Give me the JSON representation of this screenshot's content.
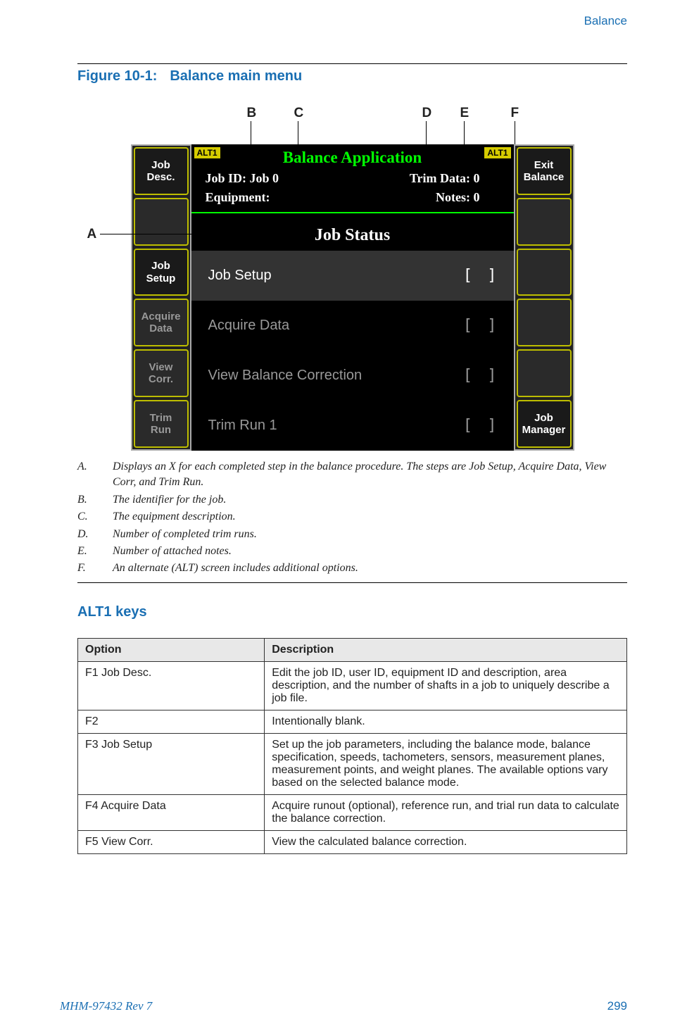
{
  "header": {
    "section_title": "Balance"
  },
  "figure": {
    "label": "Figure 10-1:",
    "title": "Balance main menu",
    "callouts": {
      "A": "A",
      "B": "B",
      "C": "C",
      "D": "D",
      "E": "E",
      "F": "F"
    }
  },
  "device": {
    "alt_chip": "ALT1",
    "app_title": "Balance Application",
    "info": {
      "job_id_label": "Job ID:",
      "job_id_value": "Job 0",
      "trim_label": "Trim Data:",
      "trim_value": "0",
      "equipment_label": "Equipment:",
      "equipment_value": "",
      "notes_label": "Notes:",
      "notes_value": "0"
    },
    "job_status_heading": "Job Status",
    "status_items": [
      {
        "label": "Job Setup",
        "mark": "[   ]"
      },
      {
        "label": "Acquire Data",
        "mark": "[   ]"
      },
      {
        "label": "View Balance Correction",
        "mark": "[   ]"
      },
      {
        "label": "Trim Run 1",
        "mark": "[   ]"
      }
    ],
    "left_buttons": {
      "b1": "Job\nDesc.",
      "b2": "",
      "b3": "Job\nSetup",
      "b4": "Acquire\nData",
      "b5": "View\nCorr.",
      "b6": "Trim\nRun"
    },
    "right_buttons": {
      "b1": "Exit\nBalance",
      "b2": "",
      "b3": "",
      "b4": "",
      "b5": "",
      "b6": "Job\nManager"
    }
  },
  "legend": {
    "A": "Displays an X for each completed step in the balance procedure. The steps are Job Setup, Acquire Data, View Corr, and Trim Run.",
    "B": "The identifier for the job.",
    "C": "The equipment description.",
    "D": "Number of completed trim runs.",
    "E": "Number of attached notes.",
    "F": "An alternate (ALT) screen includes additional options."
  },
  "alt1": {
    "heading": "ALT1 keys",
    "col_option": "Option",
    "col_desc": "Description",
    "rows": [
      {
        "opt": "F1 Job Desc.",
        "desc": "Edit the job ID, user ID, equipment ID and description, area description, and the number of shafts in a job to uniquely describe a job file."
      },
      {
        "opt": "F2",
        "desc": "Intentionally blank."
      },
      {
        "opt": "F3 Job Setup",
        "desc": "Set up the job parameters, including the balance mode, balance specification, speeds, tachometers, sensors, measurement planes, measurement points, and weight planes. The available options vary based on the selected balance mode."
      },
      {
        "opt": "F4 Acquire Data",
        "desc": "Acquire runout (optional), reference run, and trial run data to calculate the balance correction."
      },
      {
        "opt": "F5 View Corr.",
        "desc": "View the calculated balance correction."
      }
    ]
  },
  "footer": {
    "docid": "MHM-97432 Rev 7",
    "page": "299"
  }
}
